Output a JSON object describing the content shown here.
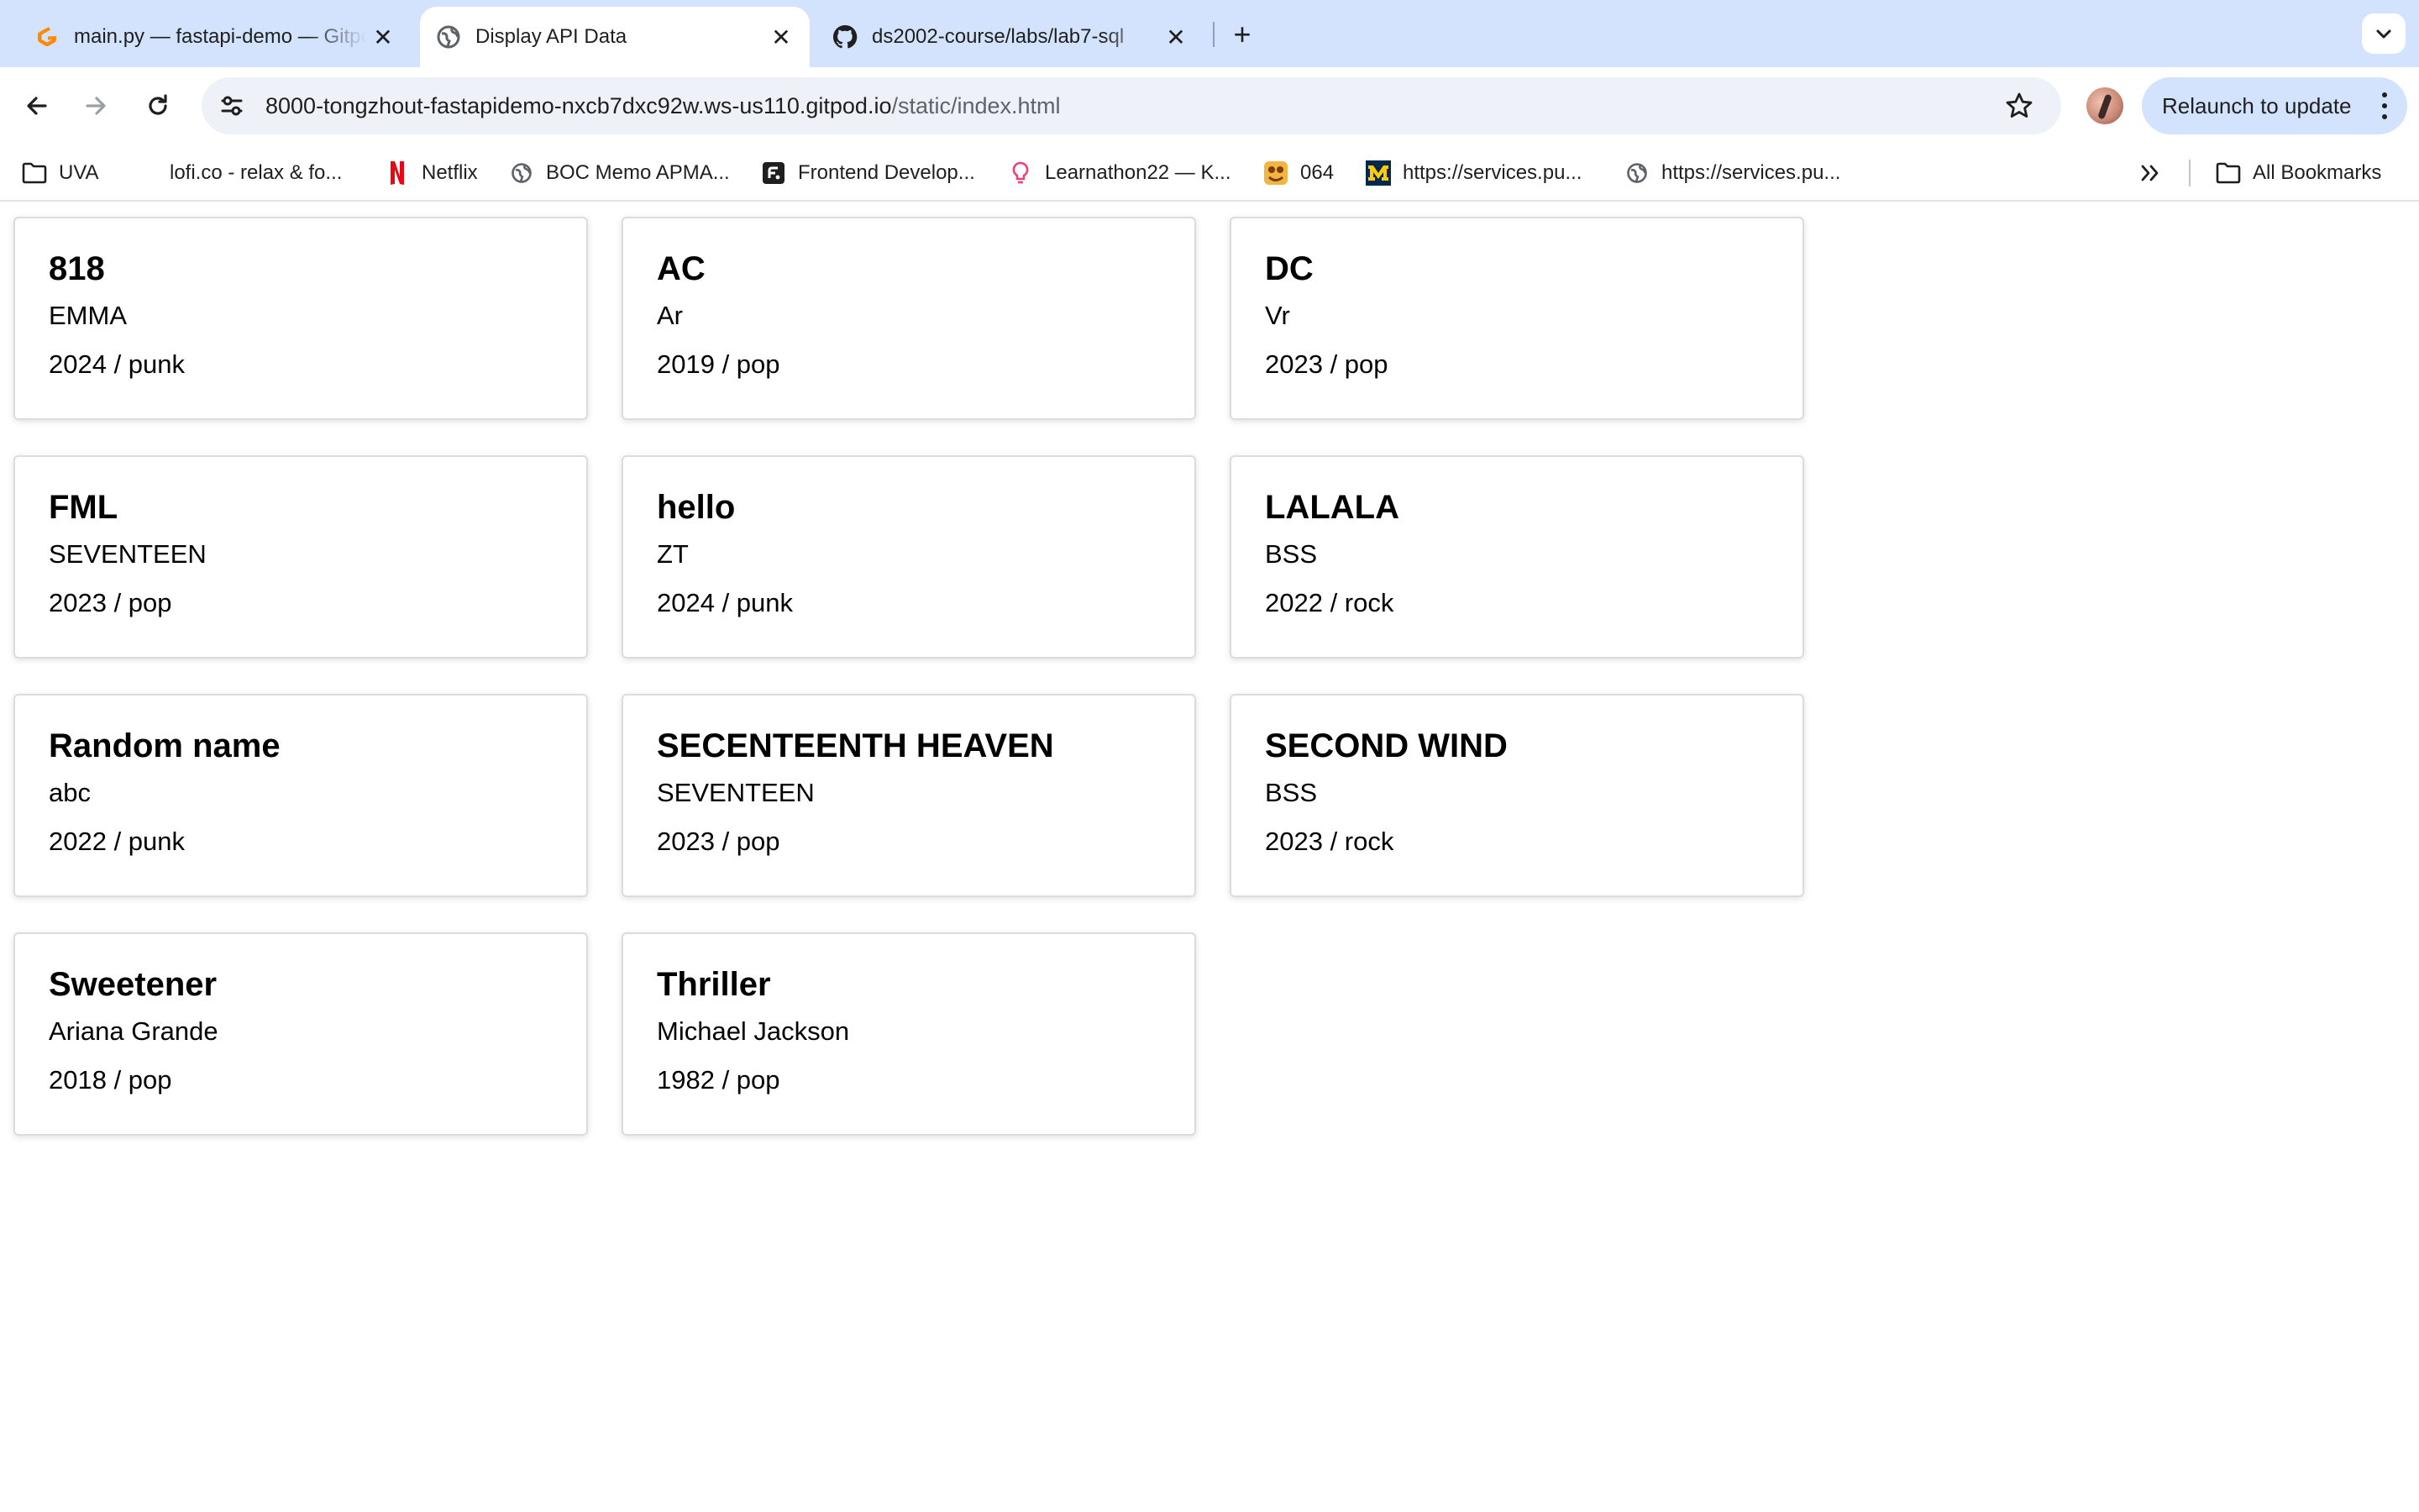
{
  "browser": {
    "tabs": [
      {
        "title": "main.py — fastapi-demo — Gitpod",
        "favicon": "gitpod-icon",
        "active": false
      },
      {
        "title": "Display API Data",
        "favicon": "globe-icon",
        "active": true
      },
      {
        "title": "ds2002-course/labs/lab7-sql",
        "favicon": "github-icon",
        "active": false
      }
    ],
    "address_bar": {
      "host": "8000-tongzhout-fastapidemo-nxcb7dxc92w.ws-us110.gitpod.io",
      "path": "/static/index.html"
    },
    "relaunch_label": "Relaunch to update",
    "bookmarks": [
      {
        "label": "UVA",
        "icon": "folder-icon"
      },
      {
        "label": "lofi.co - relax & fo...",
        "icon": "none"
      },
      {
        "label": "Netflix",
        "icon": "netflix-icon"
      },
      {
        "label": "BOC Memo APMA...",
        "icon": "globe-icon"
      },
      {
        "label": "Frontend Develop...",
        "icon": "frontend-mentor-icon"
      },
      {
        "label": "Learnathon22 — K...",
        "icon": "lightbulb-icon"
      },
      {
        "label": "064",
        "icon": "game-icon"
      },
      {
        "label": "https://services.pu...",
        "icon": "michigan-icon"
      },
      {
        "label": "https://services.pu...",
        "icon": "globe-icon"
      }
    ],
    "all_bookmarks_label": "All Bookmarks"
  },
  "albums": [
    {
      "title": "818",
      "artist": "EMMA",
      "meta": "2024 / punk"
    },
    {
      "title": "AC",
      "artist": "Ar",
      "meta": "2019 / pop"
    },
    {
      "title": "DC",
      "artist": "Vr",
      "meta": "2023 / pop"
    },
    {
      "title": "FML",
      "artist": "SEVENTEEN",
      "meta": "2023 / pop"
    },
    {
      "title": "hello",
      "artist": "ZT",
      "meta": "2024 / punk"
    },
    {
      "title": "LALALA",
      "artist": "BSS",
      "meta": "2022 / rock"
    },
    {
      "title": "Random name",
      "artist": "abc",
      "meta": "2022 / punk"
    },
    {
      "title": "SECENTEENTH HEAVEN",
      "artist": "SEVENTEEN",
      "meta": "2023 / pop"
    },
    {
      "title": "SECOND WIND",
      "artist": "BSS",
      "meta": "2023 / rock"
    },
    {
      "title": "Sweetener",
      "artist": "Ariana Grande",
      "meta": "2018 / pop"
    },
    {
      "title": "Thriller",
      "artist": "Michael Jackson",
      "meta": "1982 / pop"
    }
  ]
}
